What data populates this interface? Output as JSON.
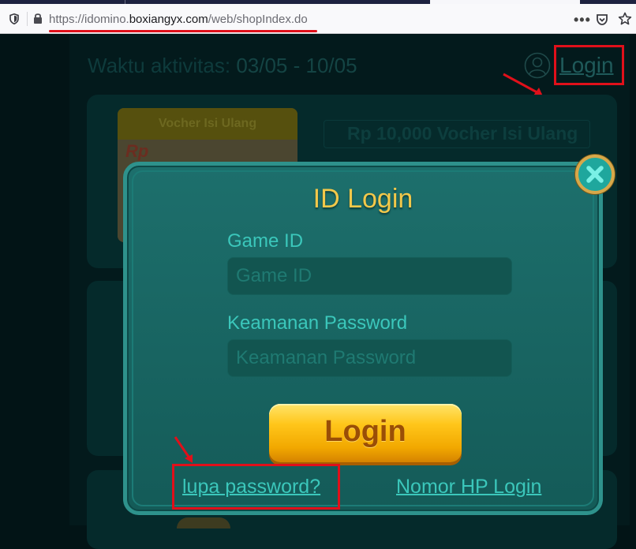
{
  "browser": {
    "url_scheme": "https://idomino.",
    "url_host": "boxiangyx.com",
    "url_path": "/web/shopIndex.do",
    "menu_icon": "more-icon",
    "pocket_icon": "pocket-icon",
    "bookmark_icon": "star-icon"
  },
  "page": {
    "activity_label": "Waktu aktivitas: ",
    "activity_dates": "03/05 - 10/05",
    "top_login": "Login",
    "voucher_card_header": "Vocher Isi Ulang",
    "voucher_card_currency": "Rp",
    "voucher_title": "Rp 10,000 Vocher Isi Ulang"
  },
  "modal": {
    "title": "ID Login",
    "game_id_label": "Game ID",
    "game_id_placeholder": "Game ID",
    "game_id_value": "",
    "password_label": "Keamanan Password",
    "password_placeholder": "Keamanan Password",
    "password_value": "",
    "login_button": "Login",
    "forgot_link": "lupa password?",
    "phone_login_link": "Nomor HP Login"
  },
  "colors": {
    "annotation_red": "#e0101a",
    "accent_teal": "#3bc7bb",
    "title_gold": "#f2c84a"
  }
}
